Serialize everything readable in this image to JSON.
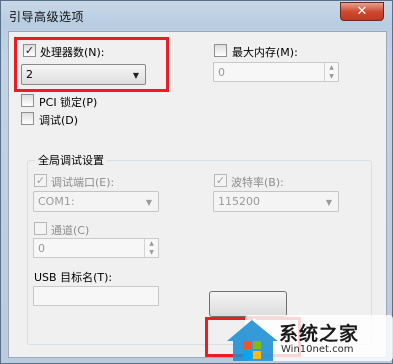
{
  "window": {
    "title": "引导高级选项",
    "close_glyph": "✕"
  },
  "processors": {
    "label": "处理器数(N):",
    "checked": true,
    "value": "2"
  },
  "max_memory": {
    "label": "最大内存(M):",
    "checked": false,
    "value": "0"
  },
  "pci_lock": {
    "label": "PCI 锁定(P)",
    "checked": false
  },
  "debug": {
    "label": "调试(D)",
    "checked": false
  },
  "global_debug": {
    "title": "全局调试设置",
    "debug_port": {
      "label": "调试端口(E):",
      "checked": true,
      "value": "COM1:"
    },
    "baud_rate": {
      "label": "波特率(B):",
      "checked": true,
      "value": "115200"
    },
    "channel": {
      "label": "通道(C)",
      "checked": false,
      "value": "0"
    },
    "usb_target": {
      "label": "USB 目标名(T):",
      "value": ""
    }
  },
  "watermark": {
    "brand": "系统之家",
    "url": "Win10net.com"
  },
  "icons": {
    "check": "✓",
    "dropdown": "▼",
    "spin_up": "▲",
    "spin_down": "▼"
  },
  "colors": {
    "highlight": "#ea1c24",
    "close_button": "#c7432b"
  }
}
